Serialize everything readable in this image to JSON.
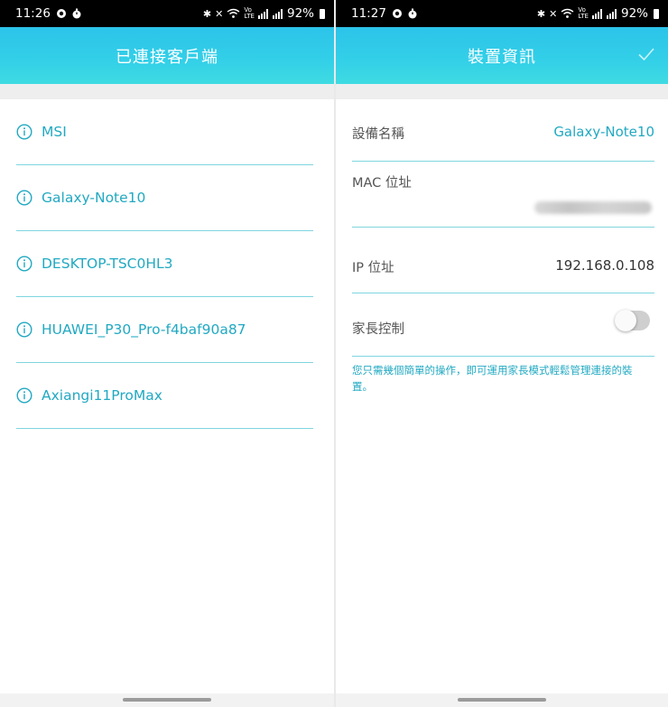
{
  "left": {
    "status": {
      "time": "11:26",
      "battery": "92%"
    },
    "title": "已連接客戶端",
    "clients": [
      {
        "name": "MSI"
      },
      {
        "name": "Galaxy-Note10"
      },
      {
        "name": "DESKTOP-TSC0HL3"
      },
      {
        "name": "HUAWEI_P30_Pro-f4baf90a87"
      },
      {
        "name": "Axiangi11ProMax"
      }
    ]
  },
  "right": {
    "status": {
      "time": "11:27",
      "battery": "92%"
    },
    "title": "裝置資訊",
    "device_name_label": "設備名稱",
    "device_name_value": "Galaxy-Note10",
    "mac_label": "MAC 位址",
    "ip_label": "IP 位址",
    "ip_value": "192.168.0.108",
    "parental_label": "家長控制",
    "parental_enabled": false,
    "hint": "您只需幾個簡單的操作，即可運用家長模式輕鬆管理連接的裝置。"
  },
  "colors": {
    "accent": "#21a9c2",
    "appbar_top": "#2cc3e9",
    "appbar_bottom": "#3fdbe2",
    "divider": "#7fd6df"
  }
}
